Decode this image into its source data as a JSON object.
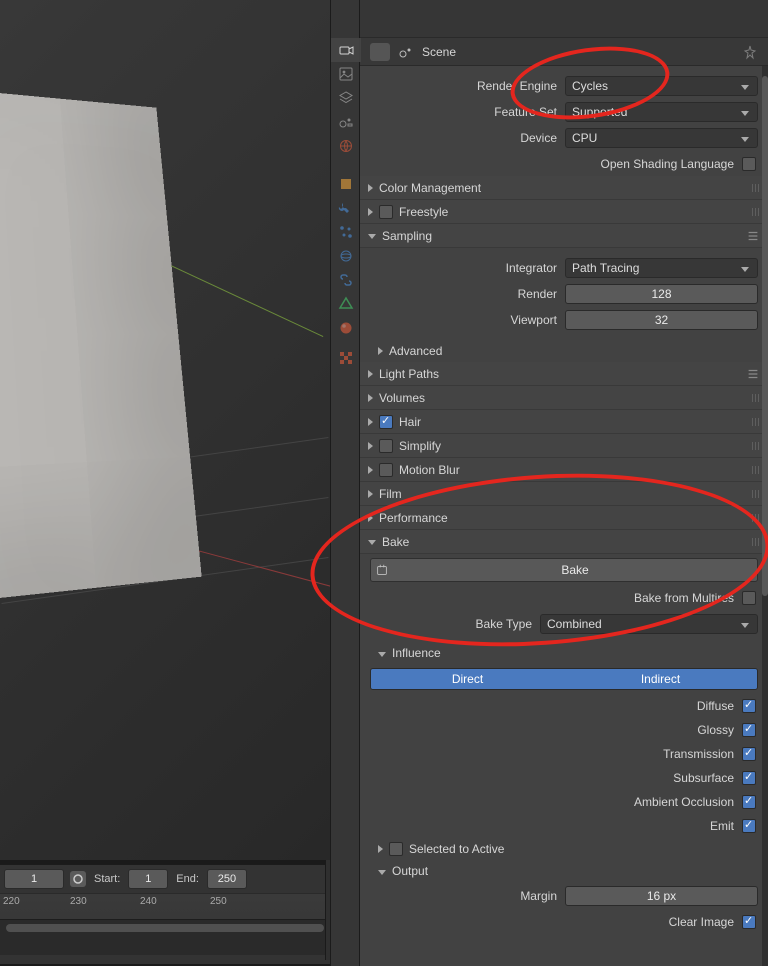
{
  "breadcrumb": "Scene",
  "render": {
    "engine_label": "Render Engine",
    "engine_value": "Cycles",
    "feature_set_label": "Feature Set",
    "feature_set_value": "Supported",
    "device_label": "Device",
    "device_value": "CPU",
    "osl_label": "Open Shading Language"
  },
  "sections": {
    "color_mgmt": "Color Management",
    "freestyle": "Freestyle",
    "sampling": "Sampling",
    "light_paths": "Light Paths",
    "volumes": "Volumes",
    "hair": "Hair",
    "simplify": "Simplify",
    "motion_blur": "Motion Blur",
    "film": "Film",
    "performance": "Performance",
    "bake": "Bake",
    "influence": "Influence",
    "output": "Output",
    "advanced": "Advanced",
    "selected_to_active": "Selected to Active"
  },
  "sampling": {
    "integrator_label": "Integrator",
    "integrator_value": "Path Tracing",
    "render_label": "Render",
    "render_value": "128",
    "viewport_label": "Viewport",
    "viewport_value": "32"
  },
  "bake": {
    "button": "Bake",
    "from_multires": "Bake from Multires",
    "type_label": "Bake Type",
    "type_value": "Combined"
  },
  "influence": {
    "direct": "Direct",
    "indirect": "Indirect",
    "diffuse": "Diffuse",
    "glossy": "Glossy",
    "transmission": "Transmission",
    "subsurface": "Subsurface",
    "ao": "Ambient Occlusion",
    "emit": "Emit"
  },
  "output": {
    "margin_label": "Margin",
    "margin_value": "16 px",
    "clear_image": "Clear Image"
  },
  "timeline": {
    "current": "1",
    "start_label": "Start:",
    "start_value": "1",
    "end_label": "End:",
    "end_value": "250",
    "ticks": [
      "220",
      "230",
      "240",
      "250"
    ]
  },
  "tab_icons": {
    "render": "camera",
    "output": "image",
    "view_layer": "layers",
    "scene": "scene",
    "world": "world",
    "object": "cube",
    "wrench": "wrench",
    "particles": "particles",
    "physics": "physics",
    "constraints": "chain",
    "mesh": "triangle",
    "material": "sphere",
    "texture": "checker"
  }
}
